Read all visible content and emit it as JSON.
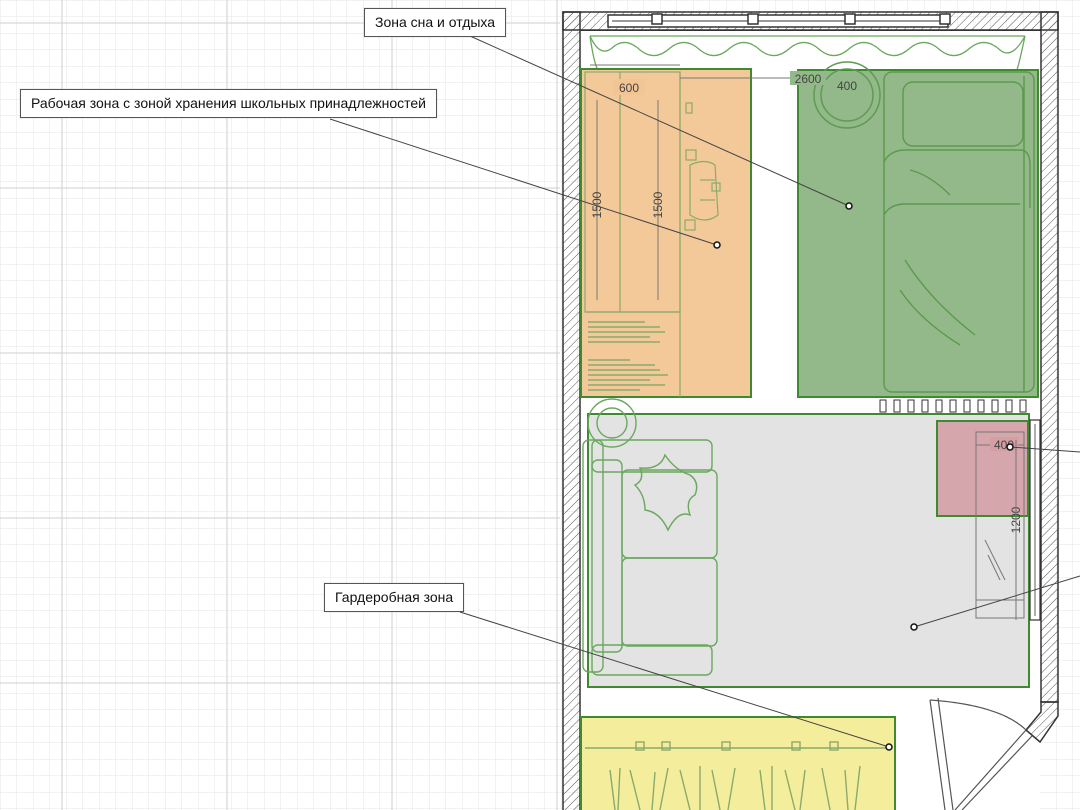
{
  "callouts": {
    "sleep_zone": "Зона сна и отдыха",
    "work_zone": "Рабочая зона с зоной хранения школьных принадлежностей",
    "wardrobe_zone": "Гардеробная зона"
  },
  "dimensions": {
    "d600": "600",
    "d2600": "2600",
    "d400_top": "400",
    "d1500_a": "1500",
    "d1500_b": "1500",
    "d400_mirror": "400",
    "d1200": "1200"
  },
  "colors": {
    "grid": "#e3e3e3",
    "wall": "#4a4a4a",
    "work_zone_fill": "#f2c694",
    "sleep_zone_fill": "#93b98a",
    "lounge_zone_fill": "#e3e3e3",
    "mirror_zone_fill": "#d39ea4",
    "wardrobe_zone_fill": "#f4ee9c",
    "zone_outline": "#3d8a2f",
    "furniture_line": "#6aa85e"
  }
}
